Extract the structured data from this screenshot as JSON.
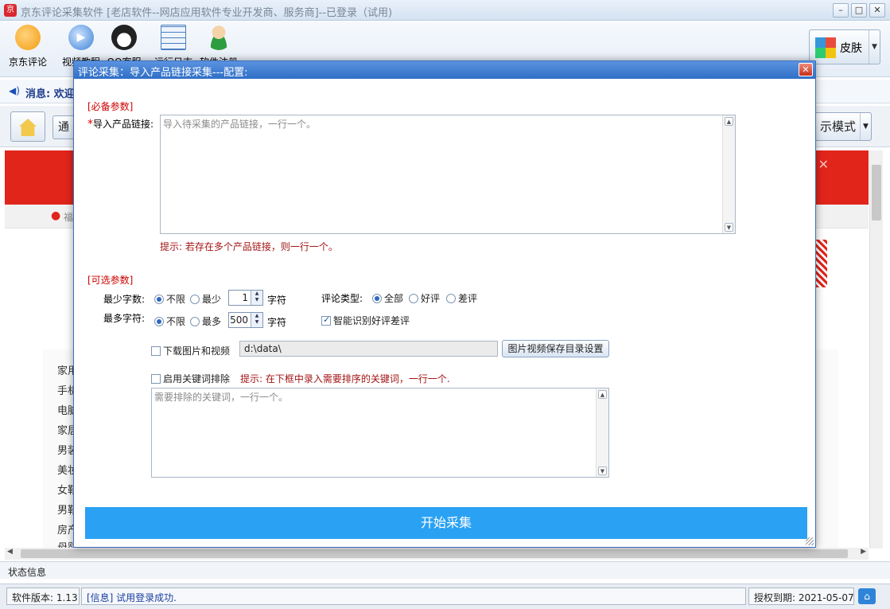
{
  "window": {
    "title": "京东评论采集软件 [老店软件--网店应用软件专业开发商、服务商]--已登录（试用)",
    "app_icon_text": "京",
    "controls": {
      "minimize": "–",
      "maximize": "□",
      "close": "✕"
    }
  },
  "toolbar": {
    "items": [
      {
        "label": "京东评论",
        "icon": "jd-comment-icon",
        "color": "#f39c12"
      },
      {
        "label": "视频教程",
        "icon": "play-icon",
        "color": "#3a83d6"
      },
      {
        "label": "QQ客服",
        "icon": "qq-icon",
        "color": "#222222"
      },
      {
        "label": "运行日志",
        "icon": "grid-icon",
        "color": "#4a7fc1"
      },
      {
        "label": "软件注册",
        "icon": "user-icon",
        "color": "#2e9d3f"
      }
    ],
    "skin_label": "皮肤"
  },
  "message": {
    "label": "消息:",
    "text": "欢迎"
  },
  "nav": {
    "tab_fragment": "通",
    "mode_label": "示模式"
  },
  "web": {
    "location_fragment": "福",
    "categories": [
      "家用",
      "手机",
      "电脑",
      "家居",
      "男装",
      "美妆",
      "女鞋",
      "男鞋",
      "房产",
      "母婴"
    ]
  },
  "status": {
    "panel_label": "状态信息",
    "version": "软件版本: 1.13",
    "info": "[信息] 试用登录成功.",
    "expiry": "授权到期: 2021-05-07"
  },
  "dialog": {
    "title": "评论采集：导入产品链接采集---配置:",
    "close_glyph": "✕",
    "required_section": "[必备参数]",
    "link_label": "导入产品链接:",
    "link_placeholder": "导入待采集的产品链接，一行一个。",
    "link_hint": "提示: 若存在多个产品链接，则一行一个。",
    "optional_section": "[可选参数]",
    "min_chars_label": "最少字数:",
    "max_chars_label": "最多字符:",
    "unlimited": "不限",
    "min_option": "最少",
    "max_option": "最多",
    "min_value": "1",
    "max_value": "500",
    "chars_unit": "字符",
    "comment_type_label": "评论类型:",
    "type_all": "全部",
    "type_good": "好评",
    "type_bad": "差评",
    "smart_detect_label": "智能识别好评差评",
    "download_media_label": "下载图片和视频",
    "save_path": "d:\\data\\",
    "save_dir_button": "图片视频保存目录设置",
    "keyword_exclude_label": "启用关键词排除",
    "keyword_hint": "提示: 在下框中录入需要排序的关键词，一行一个.",
    "keyword_placeholder": "需要排除的关键词，一行一个。",
    "start_button": "开始采集"
  },
  "colors": {
    "accent": "#2aa1f3",
    "brand_red": "#e1251b",
    "dialog_title": "#2f6fc7"
  }
}
